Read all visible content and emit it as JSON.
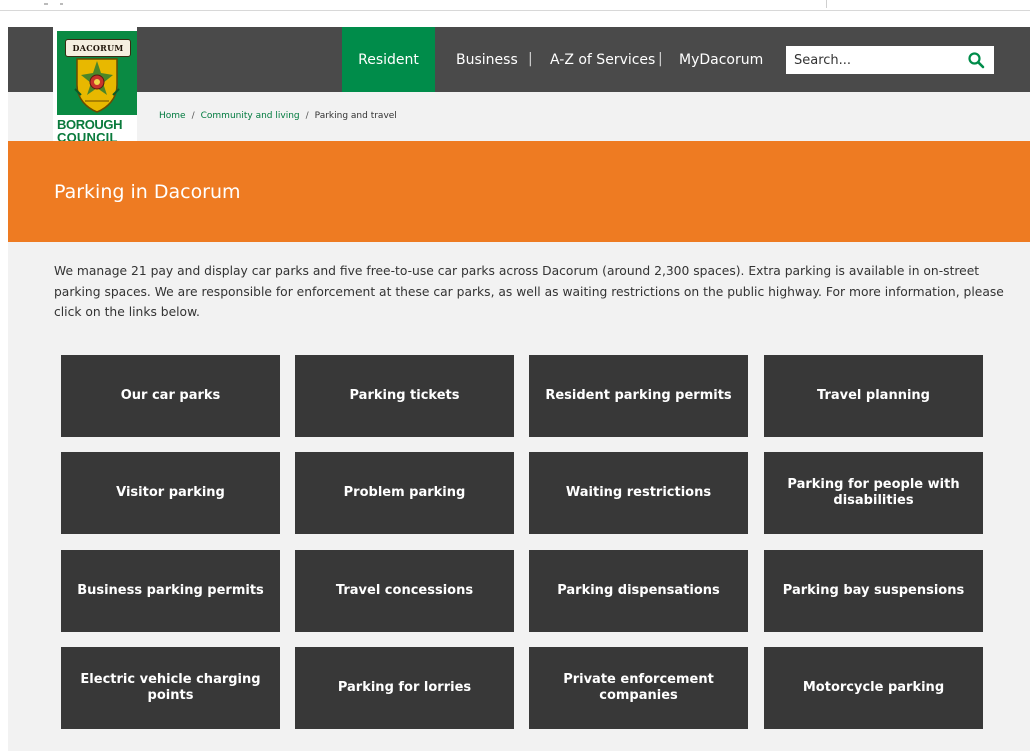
{
  "council": {
    "banner": "DACORUM",
    "name_line1": "BOROUGH",
    "name_line2": "COUNCIL"
  },
  "nav": {
    "items": [
      "Resident",
      "Business",
      "A-Z of Services",
      "MyDacorum"
    ],
    "separator": "|",
    "search_placeholder": "Search...",
    "search_icon": "search-icon",
    "active_color": "#008c4a"
  },
  "breadcrumb": {
    "items": [
      "Home",
      "Community and living",
      "Parking and travel"
    ],
    "separator": "/"
  },
  "page": {
    "title": "Parking in Dacorum",
    "intro": "We manage 21 pay and display car parks and five free-to-use car parks across Dacorum (around 2,300 spaces). Extra parking is available in on-street parking spaces. We are responsible for enforcement at these car parks, as well as waiting restrictions on the public highway. For more information, please click on the links below.",
    "hero_color": "#ee7b22"
  },
  "tiles": [
    "Our car parks",
    "Parking tickets",
    "Resident parking permits",
    "Travel planning",
    "Visitor parking",
    "Problem parking",
    "Waiting restrictions",
    "Parking for people with disabilities",
    "Business parking permits",
    "Travel concessions",
    "Parking dispensations",
    "Parking bay suspensions",
    "Electric vehicle charging points",
    "Parking for lorries",
    "Private enforcement companies",
    "Motorcycle parking"
  ]
}
